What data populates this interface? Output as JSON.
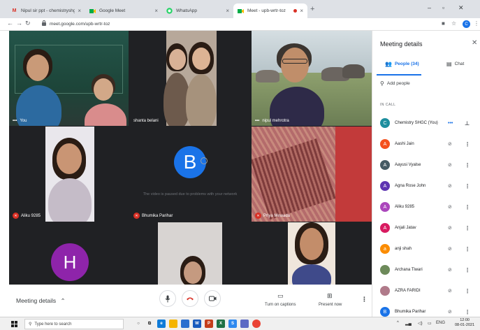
{
  "browser": {
    "tabs": [
      {
        "title": "Nipul sir ppt - chemistryshgc@gm",
        "icon": "gmail-icon",
        "active": false
      },
      {
        "title": "Google Meet",
        "icon": "google-meet-icon",
        "active": false
      },
      {
        "title": "WhatsApp",
        "icon": "whatsapp-icon",
        "active": false
      },
      {
        "title": "Meet - upb-wrtr-toz",
        "icon": "google-meet-icon",
        "active": true
      }
    ],
    "url": "meet.google.com/upb-wrtr-toz"
  },
  "tiles": [
    {
      "name": "You",
      "muted": false,
      "more": true
    },
    {
      "name": "shanta belani",
      "muted": false,
      "more": false
    },
    {
      "name": "nipul mehrotra",
      "muted": false,
      "more": true
    },
    {
      "name": "Aliku 9285",
      "muted": true,
      "more": false
    },
    {
      "name": "Bhumika Parihar",
      "muted": true,
      "more": false,
      "avatar_letter": "B",
      "avatar_color": "#1a73e8",
      "message": "The video is paused due to problems with your network"
    },
    {
      "name": "Priya Mewada",
      "muted": true,
      "more": false
    },
    {
      "name": "",
      "avatar_letter": "H",
      "avatar_color": "#8e24aa"
    },
    {
      "name": ""
    },
    {
      "name": ""
    }
  ],
  "bottombar": {
    "meeting_details": "Meeting details",
    "captions_label": "Turn on captions",
    "present_label": "Present now"
  },
  "panel": {
    "title": "Meeting details",
    "people_tab": "People (34)",
    "chat_tab": "Chat",
    "add_people": "Add people",
    "in_call": "IN CALL",
    "participants": [
      {
        "name": "Chemistry SHGC (You)",
        "letter": "C",
        "color": "#1e8e9e",
        "self": true
      },
      {
        "name": "Aashi Jain",
        "letter": "A",
        "color": "#f4511e"
      },
      {
        "name": "Aayusi Vyalse",
        "letter": "A",
        "color": "#455a64"
      },
      {
        "name": "Agna Rose John",
        "letter": "A",
        "color": "#5e35b1"
      },
      {
        "name": "Aliku 9285",
        "letter": "A",
        "color": "#ab47bc"
      },
      {
        "name": "Anjali Jatav",
        "letter": "A",
        "color": "#d81b60"
      },
      {
        "name": "anji shah",
        "letter": "a",
        "color": "#fb8c00"
      },
      {
        "name": "Archana Tiwari",
        "letter": "",
        "color": "#6d8a5a"
      },
      {
        "name": "AZRA FARIDI",
        "letter": "",
        "color": "#b07a8a"
      },
      {
        "name": "Bhumika Parihar",
        "letter": "B",
        "color": "#1a73e8"
      }
    ]
  },
  "taskbar": {
    "search_placeholder": "Type here to search",
    "tray_lang": "ENG",
    "time": "12:00",
    "date": "08-01-2021"
  },
  "colors": {
    "meet_dark": "#202124",
    "accent_blue": "#1a73e8",
    "hangup_red": "#d93025"
  }
}
